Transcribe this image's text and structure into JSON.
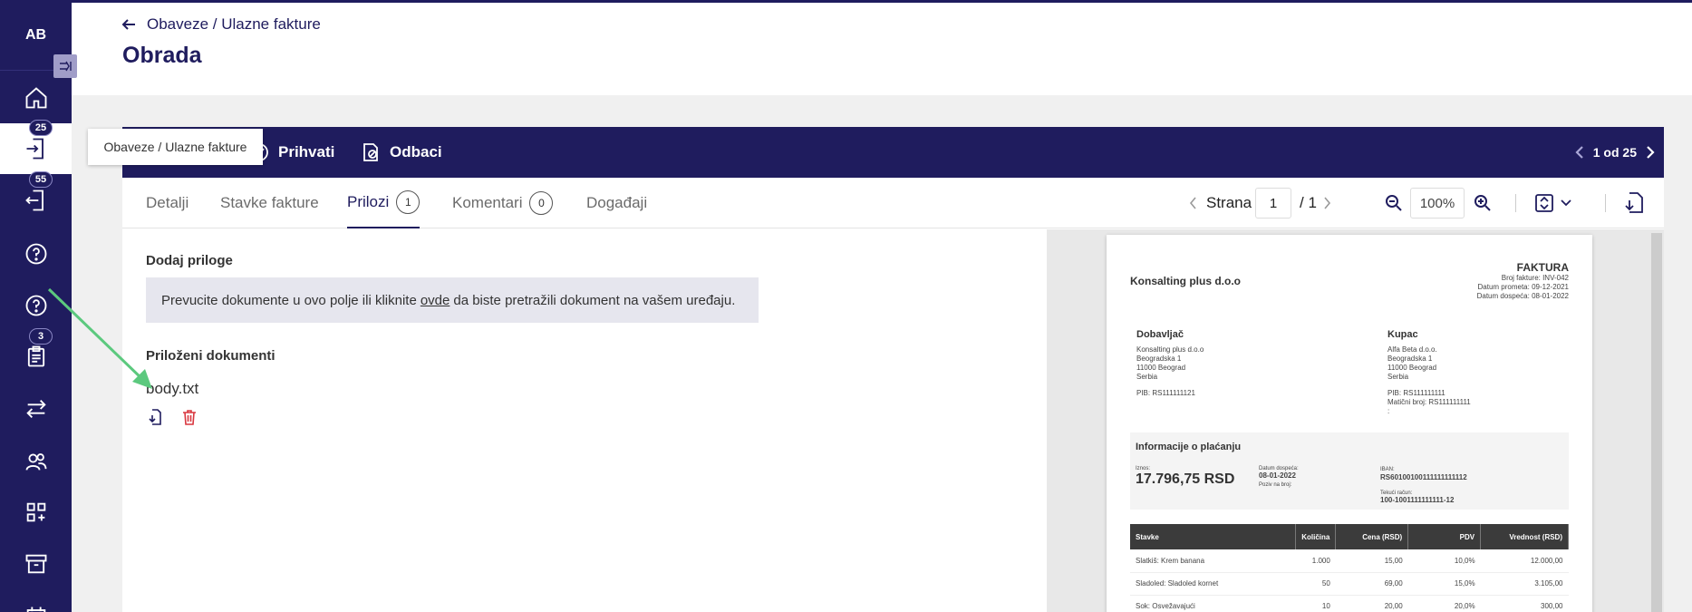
{
  "user": {
    "initials": "AB"
  },
  "sidebar": {
    "items": [
      {
        "icon": "home-icon"
      },
      {
        "icon": "login-icon",
        "badge": "25"
      },
      {
        "icon": "logout-icon",
        "badge": "55"
      },
      {
        "icon": "help-icon"
      },
      {
        "icon": "help-icon"
      },
      {
        "icon": "clipboard-icon",
        "badge": "3"
      },
      {
        "icon": "transfer-icon"
      },
      {
        "icon": "users-icon"
      },
      {
        "icon": "add-widget-icon"
      },
      {
        "icon": "archive-icon"
      }
    ]
  },
  "header": {
    "breadcrumb": "Obaveze / Ulazne fakture",
    "title": "Obrada"
  },
  "tooltip": "Obaveze / Ulazne fakture",
  "toolbar": {
    "accept_label": "Prihvati",
    "reject_label": "Odbaci",
    "pager": "1 od 25"
  },
  "tabs": [
    {
      "label": "Detalji"
    },
    {
      "label": "Stavke fakture"
    },
    {
      "label": "Prilozi",
      "count": "1"
    },
    {
      "label": "Komentari",
      "count": "0"
    },
    {
      "label": "Događaji"
    }
  ],
  "viewer": {
    "page_label": "Strana",
    "page": "1",
    "total": "/ 1",
    "zoom": "100%"
  },
  "attachments": {
    "add_title": "Dodaj priloge",
    "drop_before": "Prevucite dokumente u ovo polje ili kliknite",
    "drop_link": "ovde",
    "drop_after": "da biste pretražili dokument na vašem uređaju.",
    "list_title": "Priloženi dokumenti",
    "files": [
      "body.txt"
    ]
  },
  "invoice": {
    "company": "Konsalting plus d.o.o",
    "doc_title": "FAKTURA",
    "number": "Broj fakture: INV-042",
    "date_trade": "Datum prometa: 09-12-2021",
    "date_due": "Datum dospeća: 08-01-2022",
    "supplier_title": "Dobavljač",
    "supplier_lines": [
      "Konsalting plus d.o.o",
      "Beogradska 1",
      "11000 Beograd",
      "Serbia"
    ],
    "supplier_pib": "PIB: RS111111121",
    "buyer_title": "Kupac",
    "buyer_lines": [
      "Alfa Beta d.o.o.",
      "Beogradska 1",
      "11000 Beograd",
      "Serbia"
    ],
    "buyer_pib": "PIB: RS111111111",
    "buyer_mb": "Matični broj: RS111111111",
    "buyer_extra": ":",
    "payment_title": "Informacije o plaćanju",
    "amount_label": "Iznos:",
    "amount": "17.796,75 RSD",
    "due_label": "Datum dospeća:",
    "due_value": "08-01-2022",
    "ref_label": "Poziv na broj:",
    "iban_label": "IBAN:",
    "iban_value": "RS60100100111111111112",
    "account_label": "Tekući račun:",
    "account_value": "100-1001111111111-12",
    "table_headers": [
      "Stavke",
      "Količina",
      "Cena (RSD)",
      "PDV",
      "Vrednost (RSD)"
    ],
    "rows": [
      [
        "Slatkiš: Krem banana",
        "1.000",
        "15,00",
        "10,0%",
        "12.000,00"
      ],
      [
        "Sladoled: Sladoled kornet",
        "50",
        "69,00",
        "15,0%",
        "3.105,00"
      ],
      [
        "Sok: Osvežavajući",
        "10",
        "20,00",
        "20,0%",
        "300,00"
      ]
    ]
  }
}
